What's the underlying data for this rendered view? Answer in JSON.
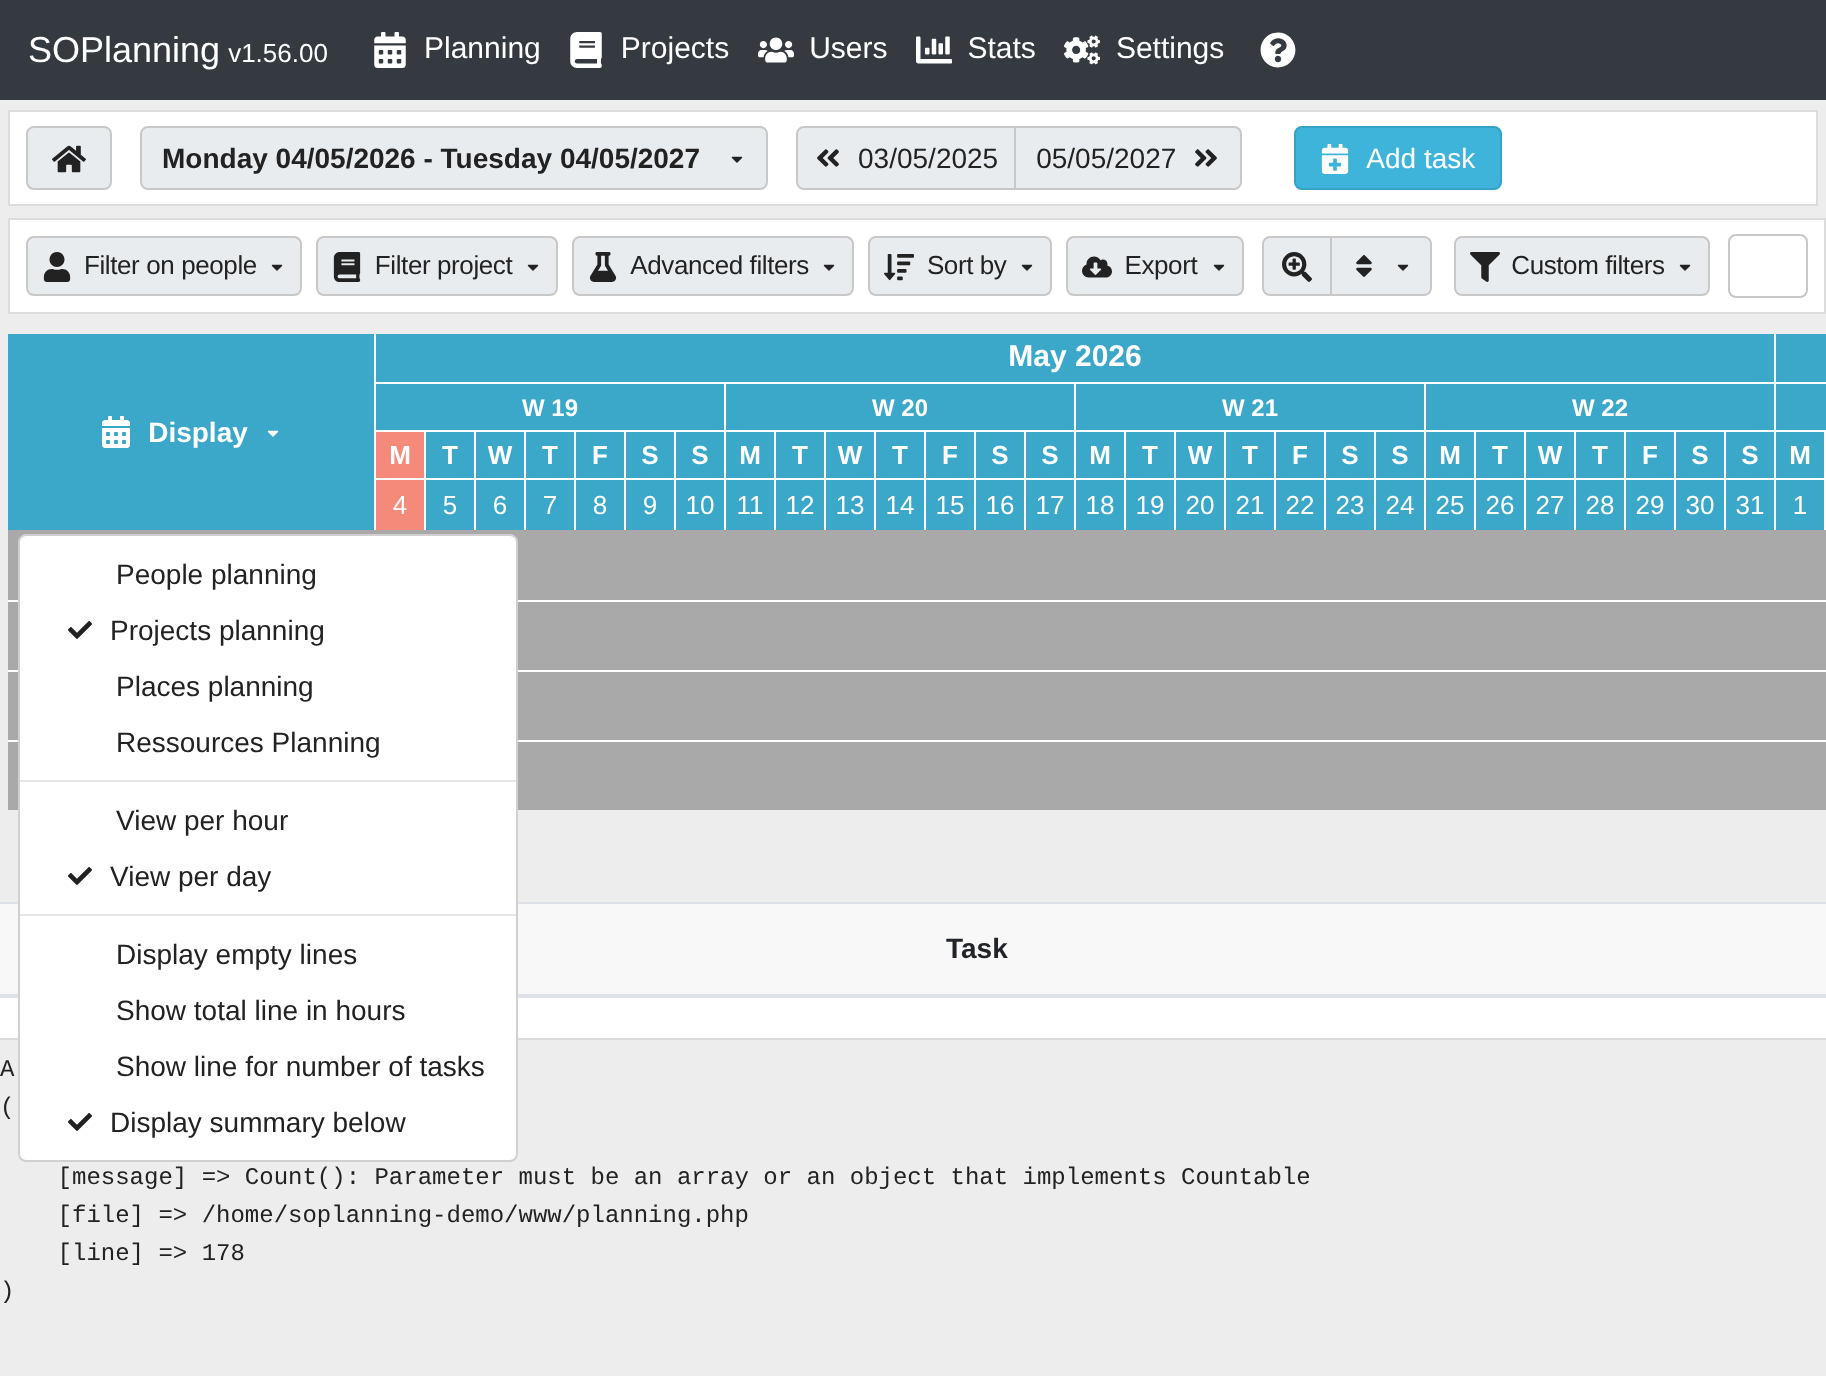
{
  "navbar": {
    "brand": "SOPlanning",
    "version": "v1.56.00",
    "items": [
      {
        "kind": "planning",
        "label": "Planning"
      },
      {
        "kind": "projects",
        "label": "Projects"
      },
      {
        "kind": "users",
        "label": "Users"
      },
      {
        "kind": "stats",
        "label": "Stats"
      },
      {
        "kind": "settings",
        "label": "Settings"
      },
      {
        "kind": "help"
      }
    ]
  },
  "toolbar": {
    "date_range": "Monday 04/05/2026 - Tuesday 04/05/2027",
    "prev": "03/05/2025",
    "next": "05/05/2027",
    "add_task": "Add task"
  },
  "filters": [
    {
      "kind": "people",
      "label": "Filter on people"
    },
    {
      "kind": "project",
      "label": "Filter project"
    },
    {
      "kind": "advanced",
      "label": "Advanced filters"
    },
    {
      "kind": "sort",
      "label": "Sort by"
    },
    {
      "kind": "export",
      "label": "Export"
    },
    {
      "kind": "zoom"
    },
    {
      "kind": "custom",
      "label": "Custom filters"
    }
  ],
  "planning": {
    "display": "Display",
    "month": "May 2026",
    "weeks": [
      "W 19",
      "W 20",
      "W 21",
      "W 22"
    ],
    "days": [
      {
        "letter": "M",
        "date": "4",
        "today": true
      },
      {
        "letter": "T",
        "date": "5",
        "today": false
      },
      {
        "letter": "W",
        "date": "6",
        "today": false
      },
      {
        "letter": "T",
        "date": "7",
        "today": false
      },
      {
        "letter": "F",
        "date": "8",
        "today": false
      },
      {
        "letter": "S",
        "date": "9",
        "today": false
      },
      {
        "letter": "S",
        "date": "10",
        "today": false
      },
      {
        "letter": "M",
        "date": "11",
        "today": false
      },
      {
        "letter": "T",
        "date": "12",
        "today": false
      },
      {
        "letter": "W",
        "date": "13",
        "today": false
      },
      {
        "letter": "T",
        "date": "14",
        "today": false
      },
      {
        "letter": "F",
        "date": "15",
        "today": false
      },
      {
        "letter": "S",
        "date": "16",
        "today": false
      },
      {
        "letter": "S",
        "date": "17",
        "today": false
      },
      {
        "letter": "M",
        "date": "18",
        "today": false
      },
      {
        "letter": "T",
        "date": "19",
        "today": false
      },
      {
        "letter": "W",
        "date": "20",
        "today": false
      },
      {
        "letter": "T",
        "date": "21",
        "today": false
      },
      {
        "letter": "F",
        "date": "22",
        "today": false
      },
      {
        "letter": "S",
        "date": "23",
        "today": false
      },
      {
        "letter": "S",
        "date": "24",
        "today": false
      },
      {
        "letter": "M",
        "date": "25",
        "today": false
      },
      {
        "letter": "T",
        "date": "26",
        "today": false
      },
      {
        "letter": "W",
        "date": "27",
        "today": false
      },
      {
        "letter": "T",
        "date": "28",
        "today": false
      },
      {
        "letter": "F",
        "date": "29",
        "today": false
      },
      {
        "letter": "S",
        "date": "30",
        "today": false
      },
      {
        "letter": "S",
        "date": "31",
        "today": false
      },
      {
        "letter": "M",
        "date": "1",
        "today": false
      }
    ]
  },
  "display_menu": [
    [
      {
        "label": "People planning",
        "checked": false
      },
      {
        "label": "Projects planning",
        "checked": true
      },
      {
        "label": "Places planning",
        "checked": false
      },
      {
        "label": "Ressources Planning",
        "checked": false
      }
    ],
    [
      {
        "label": "View per hour",
        "checked": false
      },
      {
        "label": "View per day",
        "checked": true
      }
    ],
    [
      {
        "label": "Display empty lines",
        "checked": false
      },
      {
        "label": "Show total line in hours",
        "checked": false
      },
      {
        "label": "Show line for number of tasks",
        "checked": false
      },
      {
        "label": "Display summary below",
        "checked": true
      }
    ]
  ],
  "summary_table": {
    "columns": [
      "Task"
    ]
  },
  "error_output": [
    "A",
    "(",
    "    [message] => Count(): Parameter must be an array or an object that implements Countable",
    "    [file] => /home/soplanning-demo/www/planning.php",
    "    [line] => 178",
    ")"
  ]
}
